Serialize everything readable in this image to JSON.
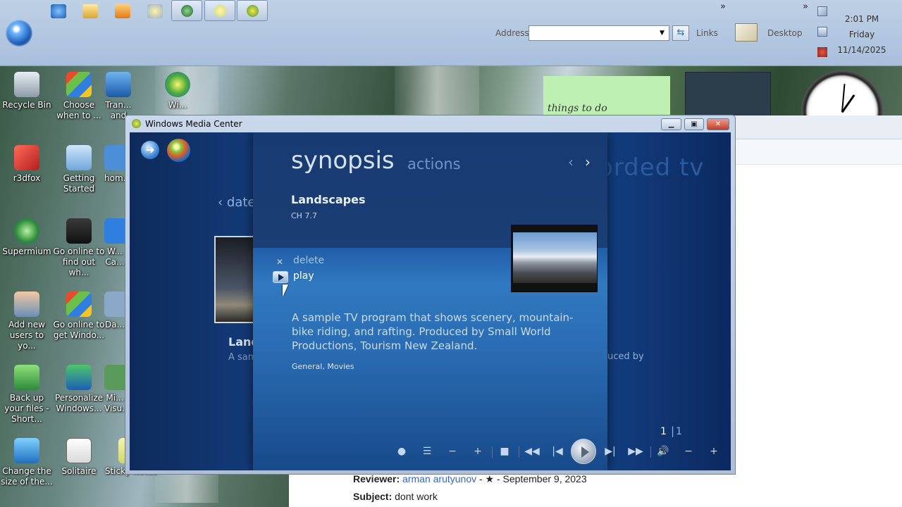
{
  "taskbar": {
    "address_label": "Address",
    "address_value": "",
    "links_label": "Links",
    "desktop_label": "Desktop",
    "overflow_glyph": "»",
    "clock": {
      "time": "2:01 PM",
      "day": "Friday",
      "date": "11/14/2025"
    }
  },
  "desktop": {
    "icons": [
      {
        "label": "Recycle Bin"
      },
      {
        "label": "Choose when to ..."
      },
      {
        "label": "Tran... and"
      },
      {
        "label": "Wi..."
      },
      {
        "label": "r3dfox"
      },
      {
        "label": "Getting Started"
      },
      {
        "label": "hom..."
      },
      {
        "label": "Supermium"
      },
      {
        "label": "Go online to find out wh..."
      },
      {
        "label": "W... Ca..."
      },
      {
        "label": "Add new users to yo..."
      },
      {
        "label": "Go online to get Windo..."
      },
      {
        "label": "Da..."
      },
      {
        "label": "Back up your files - Short..."
      },
      {
        "label": "Personalize Windows..."
      },
      {
        "label": "Mi... Visu..."
      },
      {
        "label": "Change the size of the..."
      },
      {
        "label": "Solitaire"
      },
      {
        "label": "Sticky Notes"
      }
    ],
    "note_text": "things to do"
  },
  "review": {
    "reviewer_label": "Reviewer:",
    "reviewer_name": "arman arutyunov",
    "reviewer_rest": " - ★ - September 9, 2023",
    "subject_label": "Subject:",
    "subject_value": "dont work"
  },
  "wmc": {
    "window_title": "Windows Media Center",
    "bg": {
      "date_label": "‹ date",
      "recorded_label": "orded tv",
      "land_label": "Land",
      "small_text": "A sam Small",
      "produced_text": "uced by"
    },
    "dialog": {
      "tab_synopsis": "synopsis",
      "tab_actions": "actions",
      "program_title": "Landscapes",
      "channel": "CH 7.7",
      "actions": {
        "delete": "delete",
        "play": "play"
      },
      "description": "A sample TV program that shows scenery, mountain-bike riding, and rafting. Produced by Small World Productions, Tourism New Zealand.",
      "genres": "General, Movies"
    },
    "page": {
      "current": "1",
      "sep": "|",
      "total": "1"
    }
  },
  "colors": {
    "accent": "#1f5ea8",
    "dialog_top": "#163a72",
    "title_bar": "#c9d8ea"
  }
}
